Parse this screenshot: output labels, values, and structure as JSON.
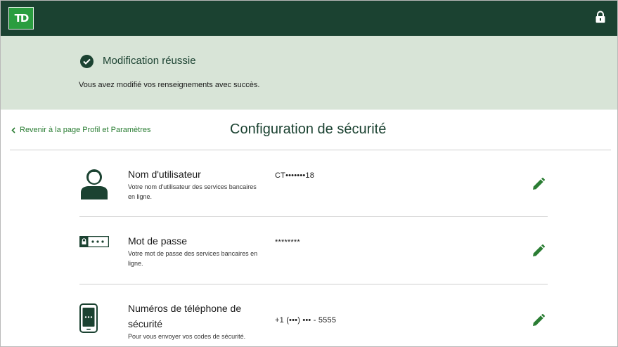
{
  "header": {
    "logo_text": "TD",
    "lock_icon": "lock-icon",
    "bg_color": "#1b4231",
    "logo_color": "#2a9d3f"
  },
  "banner": {
    "title": "Modification réussie",
    "message": "Vous avez modifié vos renseignements avec succès.",
    "bg_color": "#d8e4d7"
  },
  "nav": {
    "back_label": "Revenir à la page Profil et Paramètres"
  },
  "page": {
    "title": "Configuration de sécurité"
  },
  "rows": [
    {
      "icon": "user-icon",
      "title": "Nom d'utilisateur",
      "description": "Votre nom d'utilisateur des services bancaires en ligne.",
      "value": "CT•••••••18"
    },
    {
      "icon": "password-field-icon",
      "title": "Mot de passe",
      "description": "Votre mot de passe des services bancaires en ligne.",
      "value": "********"
    },
    {
      "icon": "mobile-phone-icon",
      "title": "Numéros de téléphone de sécurité",
      "description": "Pour vous envoyer vos codes de sécurité.",
      "value": "+1 (•••) ••• - 5555"
    }
  ],
  "accent_color": "#2a7d33"
}
